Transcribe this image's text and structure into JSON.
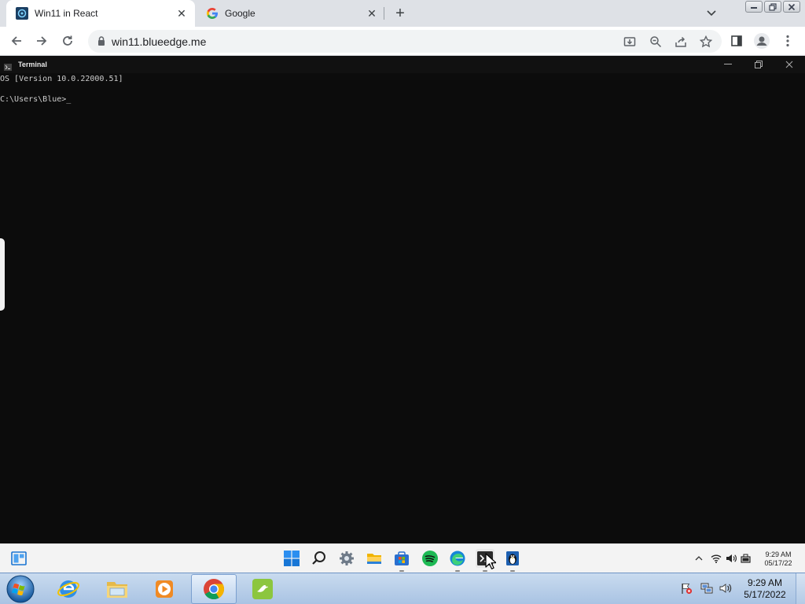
{
  "browser": {
    "tabs": [
      {
        "title": "Win11 in React",
        "favicon": "win11-react-favicon",
        "active": true
      },
      {
        "title": "Google",
        "favicon": "google-favicon",
        "active": false
      }
    ],
    "new_tab_symbol": "+",
    "close_symbol": "✕",
    "url": "win11.blueedge.me"
  },
  "terminal": {
    "title": "Terminal",
    "lines": [
      "OS [Version 10.0.22000.51]",
      "C:\\Users\\Blue>_"
    ],
    "colors": {
      "background": "#0c0c0c",
      "text": "#cccccc"
    }
  },
  "win11_taskbar": {
    "widgets_icon": "widgets-icon",
    "apps": [
      "start-icon",
      "search-icon",
      "settings-icon",
      "file-explorer-icon",
      "store-icon",
      "spotify-icon",
      "edge-icon",
      "terminal-icon",
      "notepad-icon"
    ],
    "tray_icons": [
      "chevron-up-icon",
      "wifi-icon",
      "volume-icon",
      "battery-icon"
    ],
    "time": "9:29 AM",
    "date": "05/17/22"
  },
  "win7_taskbar": {
    "apps": [
      "internet-explorer-icon",
      "windows-explorer-icon",
      "media-player-icon",
      "chrome-icon",
      "app-icon"
    ],
    "time": "9:29 AM",
    "date": "5/17/2022"
  }
}
